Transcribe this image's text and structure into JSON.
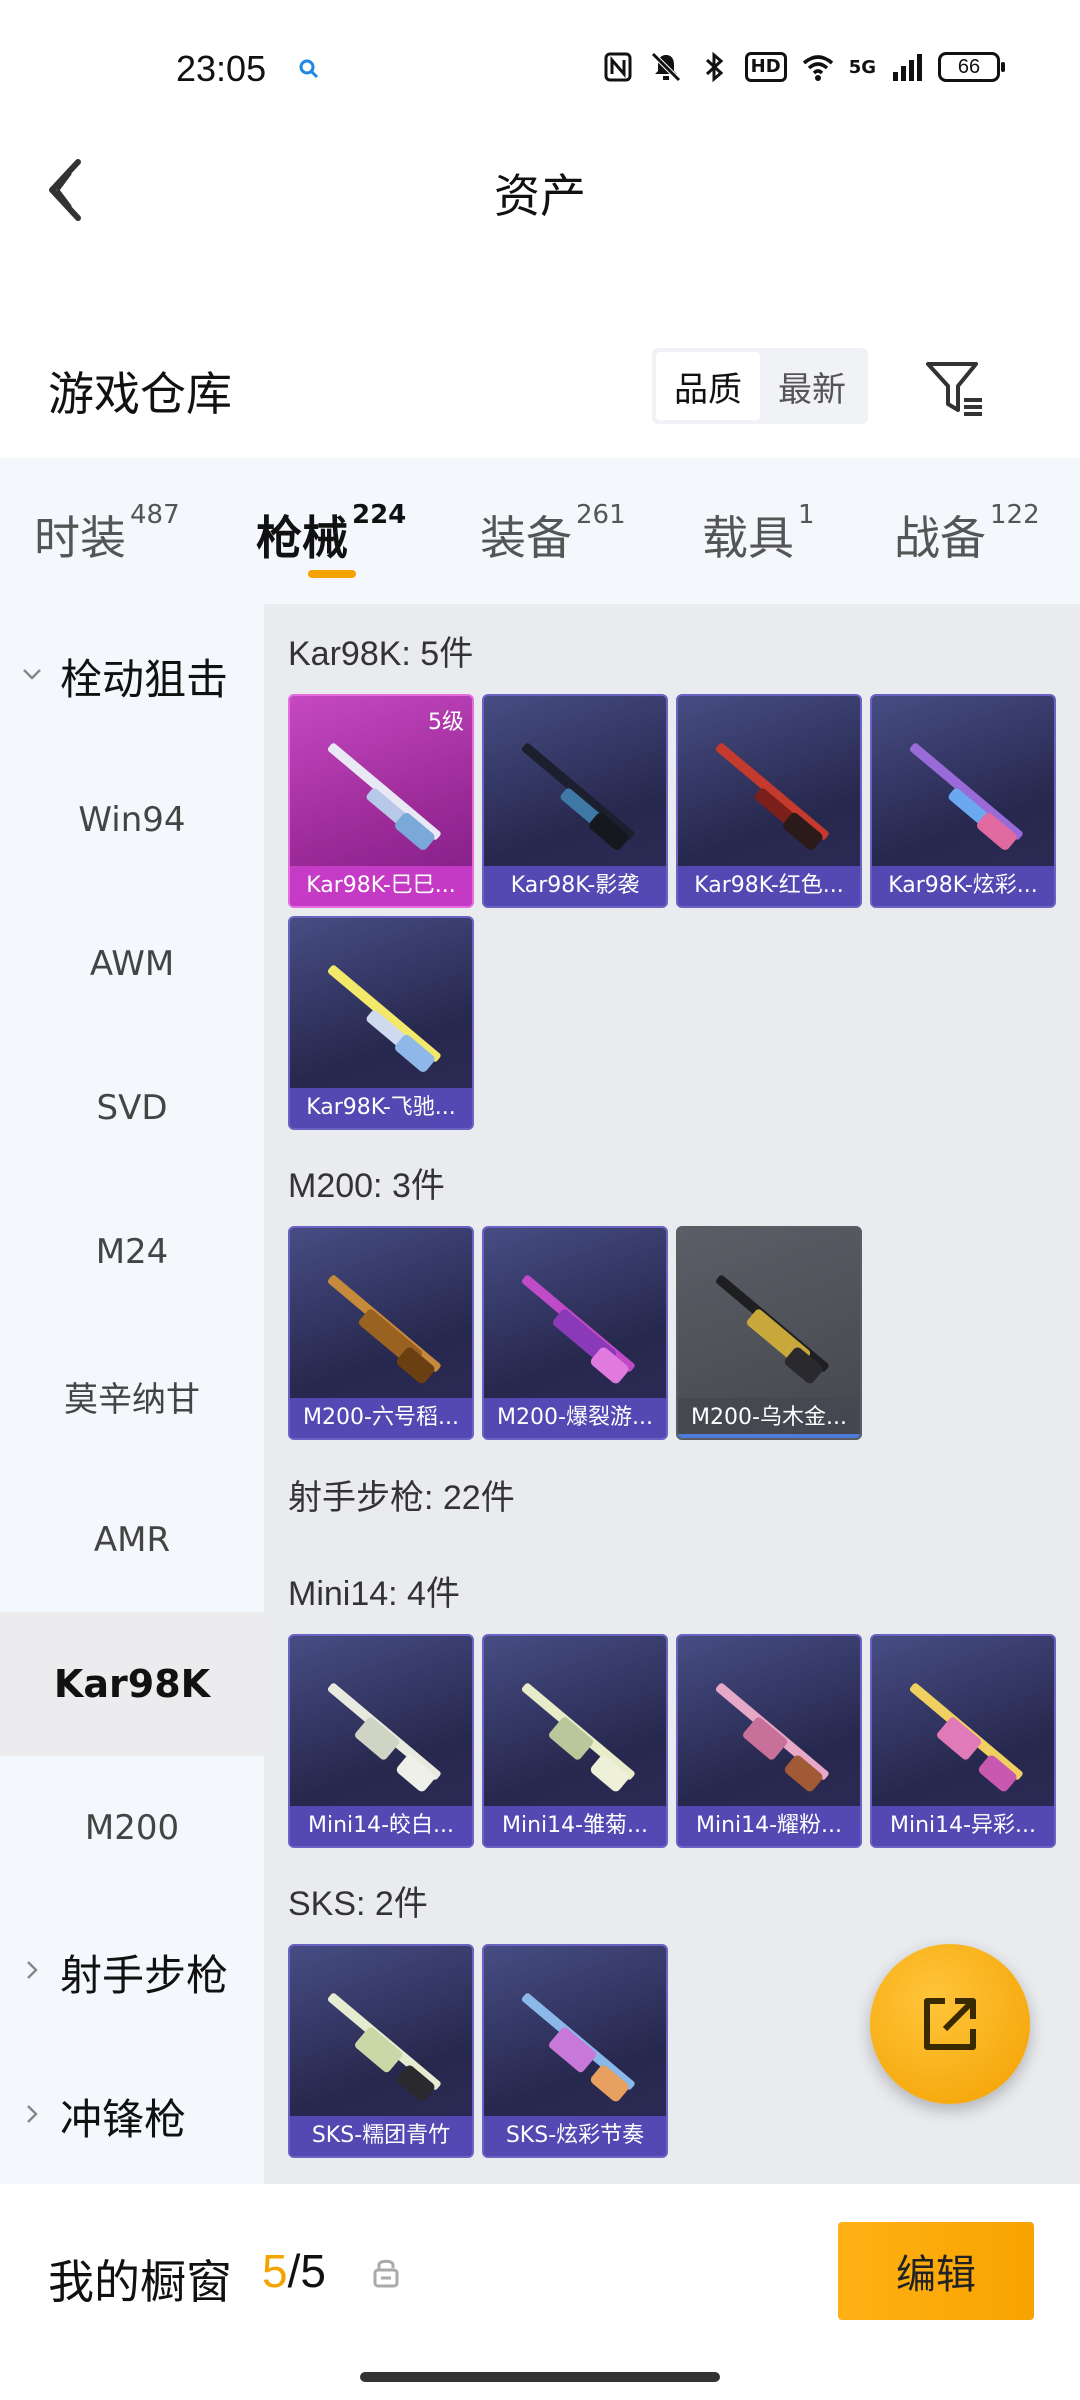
{
  "status_bar": {
    "time": "23:05",
    "battery": "66",
    "network": "5G",
    "hd": "HD",
    "icons": [
      "search-icon",
      "nfc-icon",
      "mute-icon",
      "bluetooth-icon",
      "hd-icon",
      "wifi-icon",
      "signal-icon",
      "battery-icon"
    ]
  },
  "header": {
    "title": "资产"
  },
  "warehouse": {
    "title": "游戏仓库",
    "sort_options": [
      "品质",
      "最新"
    ],
    "active_sort": "品质"
  },
  "tabs": [
    {
      "label": "时装",
      "count": "487"
    },
    {
      "label": "枪械",
      "count": "224"
    },
    {
      "label": "装备",
      "count": "261"
    },
    {
      "label": "载具",
      "count": "1"
    },
    {
      "label": "战备",
      "count": "122"
    }
  ],
  "active_tab": "枪械",
  "sidebar": {
    "items": [
      {
        "label": "栓动狙击",
        "type": "group",
        "expanded": true
      },
      {
        "label": "Win94"
      },
      {
        "label": "AWM"
      },
      {
        "label": "SVD"
      },
      {
        "label": "M24"
      },
      {
        "label": "莫辛纳甘"
      },
      {
        "label": "AMR"
      },
      {
        "label": "Kar98K",
        "active": true
      },
      {
        "label": "M200"
      },
      {
        "label": "射手步枪",
        "type": "group",
        "expanded": false
      },
      {
        "label": "冲锋枪",
        "type": "group",
        "expanded": false
      }
    ]
  },
  "content": {
    "groups": [
      {
        "title": "Kar98K: 5件",
        "items": [
          {
            "name": "Kar98K-巳巳...",
            "level": "5级",
            "rarity": "pink"
          },
          {
            "name": "Kar98K-影袭",
            "rarity": "purple"
          },
          {
            "name": "Kar98K-红色...",
            "rarity": "purple"
          },
          {
            "name": "Kar98K-炫彩...",
            "rarity": "purple"
          },
          {
            "name": "Kar98K-飞驰...",
            "rarity": "purple"
          }
        ]
      },
      {
        "title": "M200: 3件",
        "items": [
          {
            "name": "M200-六号稻...",
            "rarity": "purple"
          },
          {
            "name": "M200-爆裂游...",
            "rarity": "purple"
          },
          {
            "name": "M200-乌木金...",
            "rarity": "gray"
          }
        ]
      },
      {
        "title": "射手步枪: 22件",
        "items": []
      },
      {
        "title": "Mini14: 4件",
        "items": [
          {
            "name": "Mini14-皎白...",
            "rarity": "purple"
          },
          {
            "name": "Mini14-雏菊...",
            "rarity": "purple"
          },
          {
            "name": "Mini14-耀粉...",
            "rarity": "purple"
          },
          {
            "name": "Mini14-异彩...",
            "rarity": "purple"
          }
        ]
      },
      {
        "title": "SKS: 2件",
        "items": [
          {
            "name": "SKS-糯团青竹",
            "rarity": "purple"
          },
          {
            "name": "SKS-炫彩节奏",
            "rarity": "purple"
          }
        ]
      }
    ]
  },
  "bottom_bar": {
    "showcase_label": "我的橱窗",
    "showcase_current": "5",
    "showcase_sep": "/",
    "showcase_total": "5",
    "edit_label": "编辑"
  },
  "colors": {
    "accent": "#F5A300",
    "background": "#FFFFFF",
    "panel": "#F4F7FB",
    "content_bg": "#E9EBEF",
    "pink_rarity": "#C549C2",
    "purple_rarity": "#5C4EC4"
  }
}
